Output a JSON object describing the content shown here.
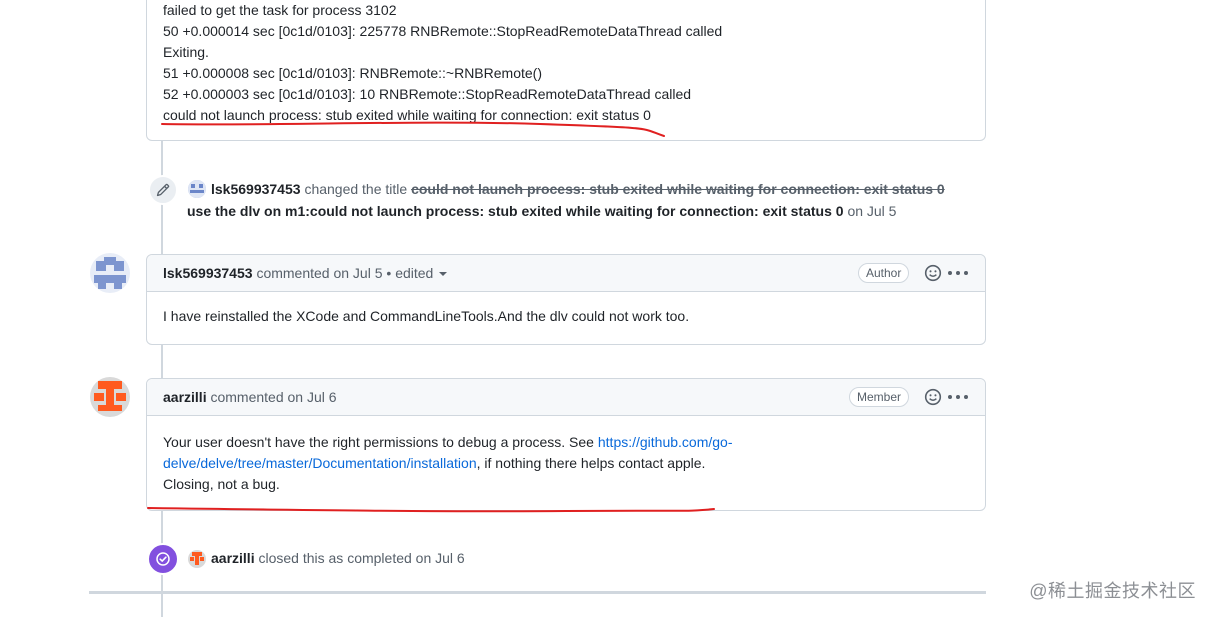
{
  "log_box": {
    "lines": [
      "failed to get the task for process 3102",
      "50 +0.000014 sec [0c1d/0103]: 225778 RNBRemote::StopReadRemoteDataThread called",
      "Exiting.",
      "51 +0.000008 sec [0c1d/0103]: RNBRemote::~RNBRemote()",
      "52 +0.000003 sec [0c1d/0103]: 10 RNBRemote::StopReadRemoteDataThread called",
      "could not launch process: stub exited while waiting for connection: exit status 0"
    ]
  },
  "title_change": {
    "user": "lsk569937453",
    "action": "changed the title",
    "old_title": "could not launch process: stub exited while waiting for connection: exit status 0",
    "new_title": "use the dlv on m1:could not launch process: stub exited while waiting for connection: exit status 0",
    "date": "on Jul 5",
    "icon": "pencil-icon"
  },
  "comment1": {
    "user": "lsk569937453",
    "meta": "commented on Jul 5",
    "edited": "• edited",
    "badge": "Author",
    "body": "I have reinstalled the XCode and CommandLineTools.And the dlv could not work too."
  },
  "comment2": {
    "user": "aarzilli",
    "meta": "commented on Jul 6",
    "badge": "Member",
    "body_pre": "Your user doesn't have the right permissions to debug a process. See ",
    "link_part1": "https://github.com/go-",
    "link_part2": "delve/delve/tree/master/Documentation/installation",
    "body_post": ", if nothing there helps contact apple.",
    "body_line3": "Closing, not a bug."
  },
  "closed_event": {
    "user": "aarzilli",
    "text": "closed this as completed on Jul 6",
    "icon": "check-circle-icon"
  },
  "watermark": "@稀土掘金技术社区",
  "colors": {
    "link": "#0969da",
    "closed": "#8250df",
    "annotation": "#e02020",
    "border": "#d0d7de"
  }
}
